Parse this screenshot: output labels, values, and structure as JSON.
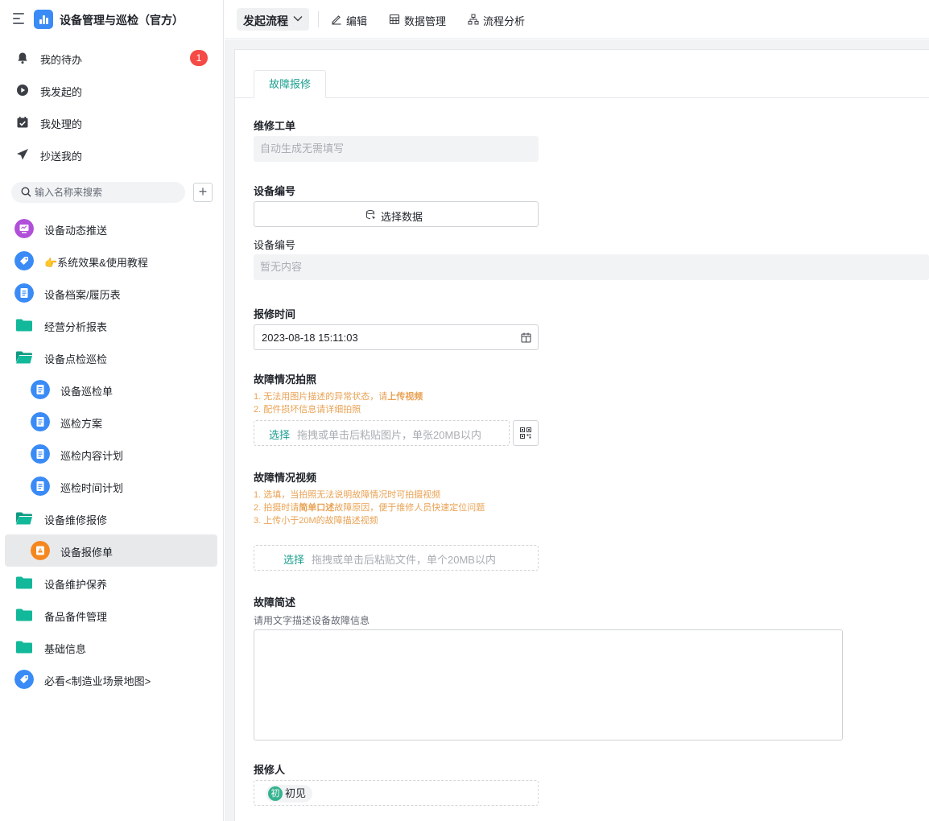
{
  "app": {
    "title": "设备管理与巡检（官方）"
  },
  "sidebar": {
    "nav": [
      {
        "label": "我的待办",
        "badge": "1",
        "icon": "bell-icon"
      },
      {
        "label": "我发起的",
        "icon": "play-circle-icon"
      },
      {
        "label": "我处理的",
        "icon": "calendar-check-icon"
      },
      {
        "label": "抄送我的",
        "icon": "send-icon"
      }
    ],
    "search_placeholder": "输入名称来搜索",
    "add_label": "+",
    "tree": [
      {
        "label": "设备动态推送",
        "icon": "monitor-icon",
        "color": "#b04fd9"
      },
      {
        "label": "👉系统效果&使用教程",
        "icon": "tag-icon",
        "color": "#3a8bf6"
      },
      {
        "label": "设备档案/履历表",
        "icon": "document-icon",
        "color": "#3a8bf6"
      },
      {
        "label": "经营分析报表",
        "icon": "folder-icon",
        "color": "#12b89a"
      },
      {
        "label": "设备点检巡检",
        "icon": "folder-open-icon",
        "color": "#12b89a"
      },
      {
        "label": "设备巡检单",
        "icon": "document-icon",
        "color": "#3a8bf6"
      },
      {
        "label": "巡检方案",
        "icon": "document-icon",
        "color": "#3a8bf6"
      },
      {
        "label": "巡检内容计划",
        "icon": "document-icon",
        "color": "#3a8bf6"
      },
      {
        "label": "巡检时间计划",
        "icon": "document-icon",
        "color": "#3a8bf6"
      },
      {
        "label": "设备维修报修",
        "icon": "folder-open-icon",
        "color": "#12b89a"
      },
      {
        "label": "设备报修单",
        "icon": "warning-icon",
        "color": "#f5871f"
      },
      {
        "label": "设备维护保养",
        "icon": "folder-icon",
        "color": "#12b89a"
      },
      {
        "label": "备品备件管理",
        "icon": "folder-icon",
        "color": "#12b89a"
      },
      {
        "label": "基础信息",
        "icon": "folder-icon",
        "color": "#12b89a"
      },
      {
        "label": "必看<制造业场景地图>",
        "icon": "tag-icon",
        "color": "#3a8bf6"
      }
    ]
  },
  "toolbar": {
    "start": "发起流程",
    "edit": "编辑",
    "data": "数据管理",
    "analysis": "流程分析"
  },
  "form": {
    "tab": "故障报修",
    "order_label": "维修工单",
    "order_placeholder": "自动生成无需填写",
    "device_label": "设备编号",
    "select_data": "选择数据",
    "device_sublabel": "设备编号",
    "device_empty": "暂无内容",
    "time_label": "报修时间",
    "time_value": "2023-08-18 15:11:03",
    "photo_label": "故障情况拍照",
    "photo_hint_1_prefix": "1. 无法用图片描述的异常状态，请",
    "photo_hint_1_bold": "上传视频",
    "photo_hint_2": "2. 配件损坏信息请详细拍照",
    "photo_pick": "选择",
    "photo_desc": "拖拽或单击后粘贴图片，单张20MB以内",
    "video_label": "故障情况视频",
    "video_hint_1": "1. 选填，当拍照无法说明故障情况时可拍摄视频",
    "video_hint_2_prefix": "2. 拍摄时请",
    "video_hint_2_bold": "简单口述",
    "video_hint_2_suffix": "故障原因，便于维修人员快速定位问题",
    "video_hint_3": "3. 上传小于20M的故障描述视频",
    "video_pick": "选择",
    "video_desc": "拖拽或单击后粘贴文件，单个20MB以内",
    "desc_label": "故障简述",
    "desc_help": "请用文字描述设备故障信息",
    "reporter_label": "报修人",
    "reporter_avatar": "初",
    "reporter_name": "初见"
  },
  "colors": {
    "accent": "#1a9f8f",
    "hint": "#e9a254",
    "badge": "#f54a45"
  }
}
